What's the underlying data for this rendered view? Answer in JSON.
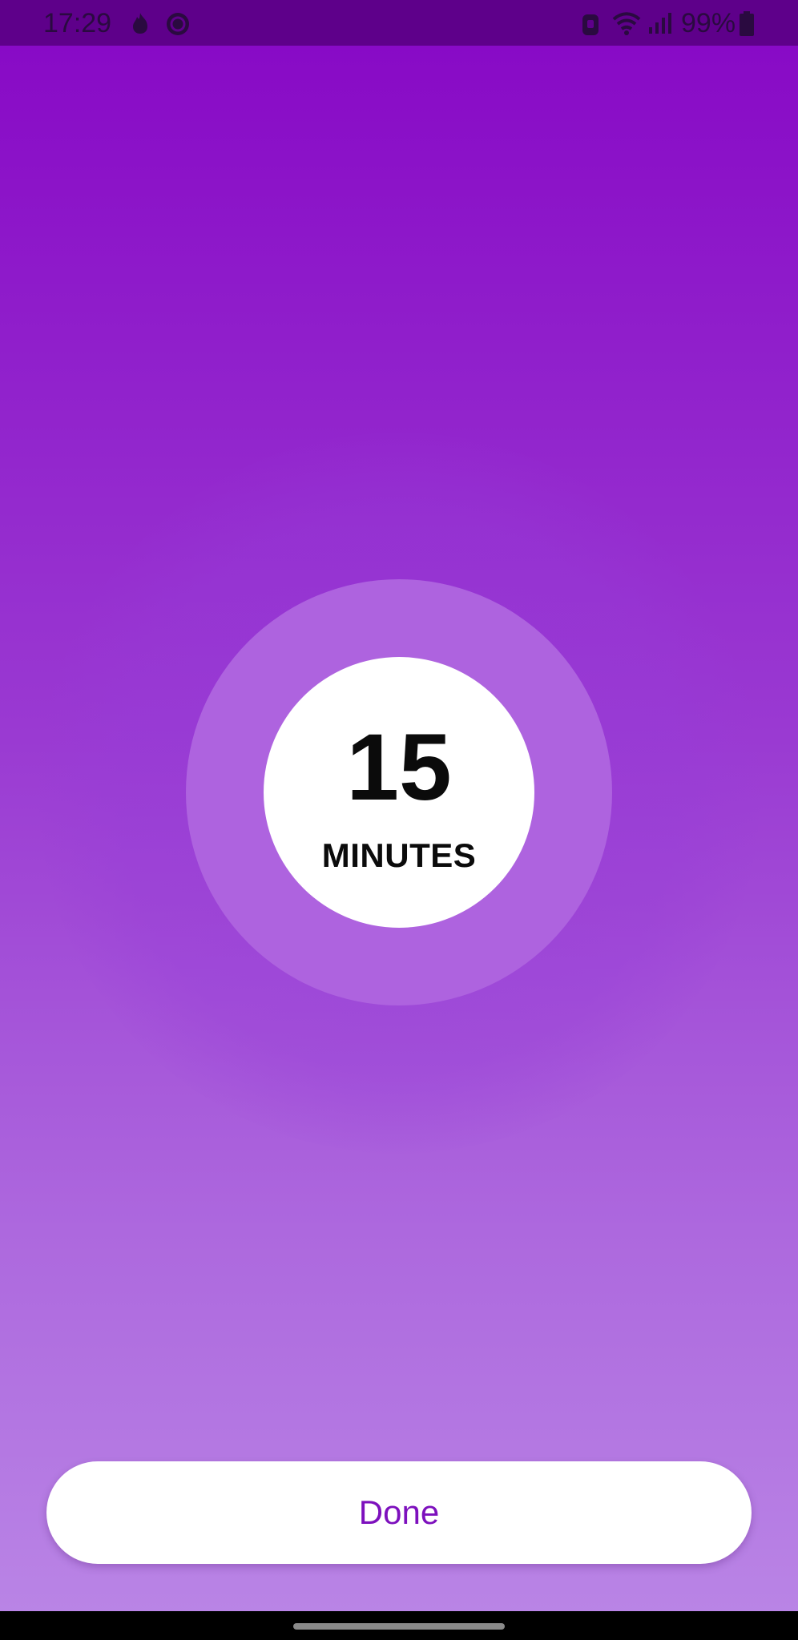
{
  "status_bar": {
    "time": "17:29",
    "battery_percent": "99%",
    "left_icons": [
      "fire-notification-icon",
      "messaging-notification-icon"
    ],
    "right_icons": [
      "alarm-icon",
      "wifi-icon",
      "signal-icon",
      "battery-icon"
    ]
  },
  "timer": {
    "value": "15",
    "unit": "MINUTES"
  },
  "actions": {
    "done_label": "Done"
  },
  "colors": {
    "accent": "#7d10bd",
    "background_top": "#8707c5",
    "background_bottom": "#ba86e6",
    "ring": "#ae63df"
  }
}
